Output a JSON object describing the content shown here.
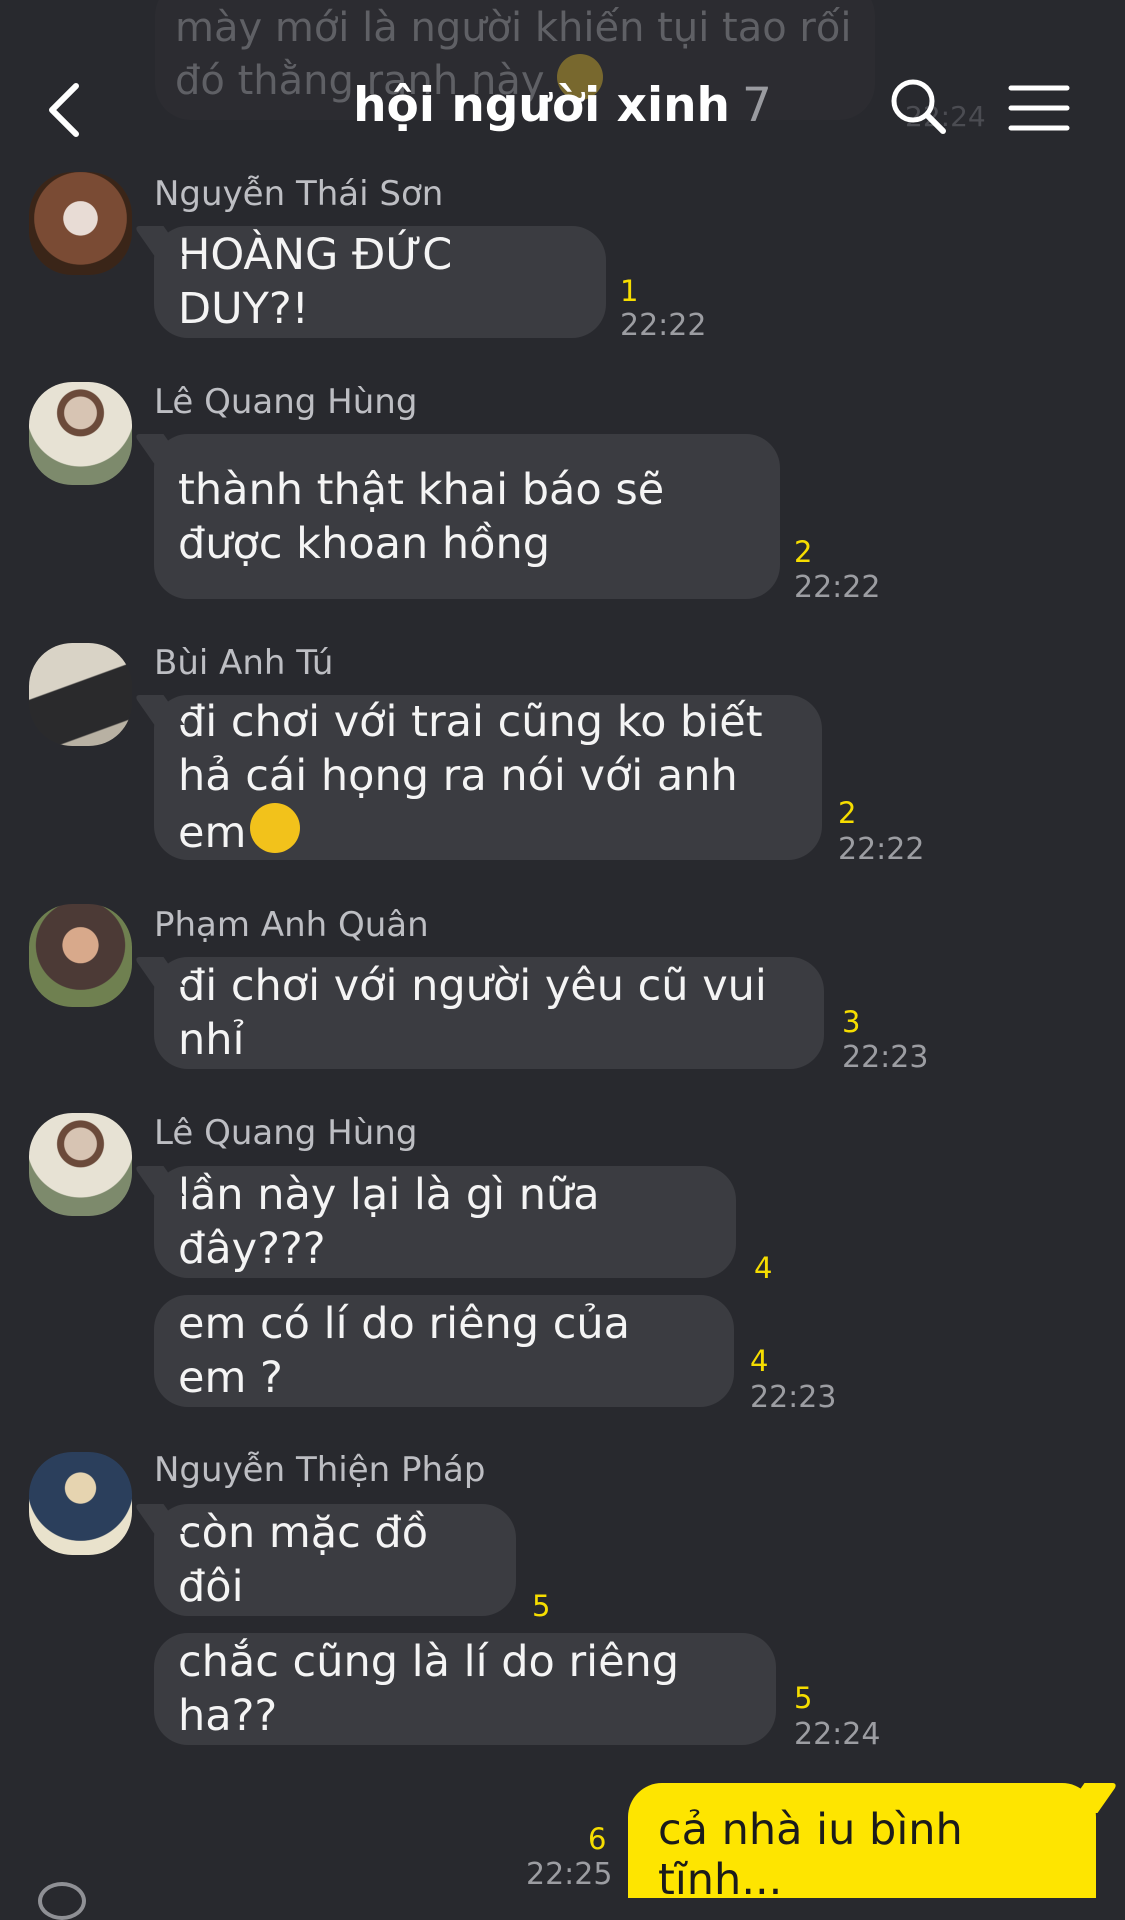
{
  "ghost": {
    "text": "mày mới là người khiến tụi tao rối đó thằng ranh này",
    "time": "22:24"
  },
  "header": {
    "title": "hội người xinh",
    "member_count": "7"
  },
  "messages": [
    {
      "sender": "Nguyễn Thái Sơn",
      "text": "HOÀNG ĐỨC DUY?!",
      "unread": "1",
      "time": "22:22"
    },
    {
      "sender": "Lê Quang Hùng",
      "text": "thành thật khai báo sẽ được khoan hồng",
      "unread": "2",
      "time": "22:22"
    },
    {
      "sender": "Bùi Anh Tú",
      "text": "đi chơi với trai cũng ko biết hả cái họng ra nói với anh em",
      "unread": "2",
      "time": "22:22"
    },
    {
      "sender": "Phạm Anh Quân",
      "text": "đi chơi với người yêu cũ vui nhỉ",
      "unread": "3",
      "time": "22:23"
    },
    {
      "sender": "Lê Quang Hùng",
      "text": "lần này lại là gì nữa đây???",
      "unread": "4",
      "time": ""
    },
    {
      "sender": "",
      "text": "em có lí do riêng của em ?",
      "unread": "4",
      "time": "22:23"
    },
    {
      "sender": "Nguyễn Thiện Pháp",
      "text": "còn mặc đồ đôi",
      "unread": "5",
      "time": ""
    },
    {
      "sender": "",
      "text": "chắc cũng là lí do riêng ha??",
      "unread": "5",
      "time": "22:24"
    }
  ],
  "my_message": {
    "text": "cả nhà iu bình tĩnh...",
    "unread": "6",
    "time": "22:25"
  },
  "colors": {
    "background": "#28292e",
    "bubble": "#3b3c41",
    "my_bubble": "#fee500",
    "unread": "#f6dd00"
  }
}
